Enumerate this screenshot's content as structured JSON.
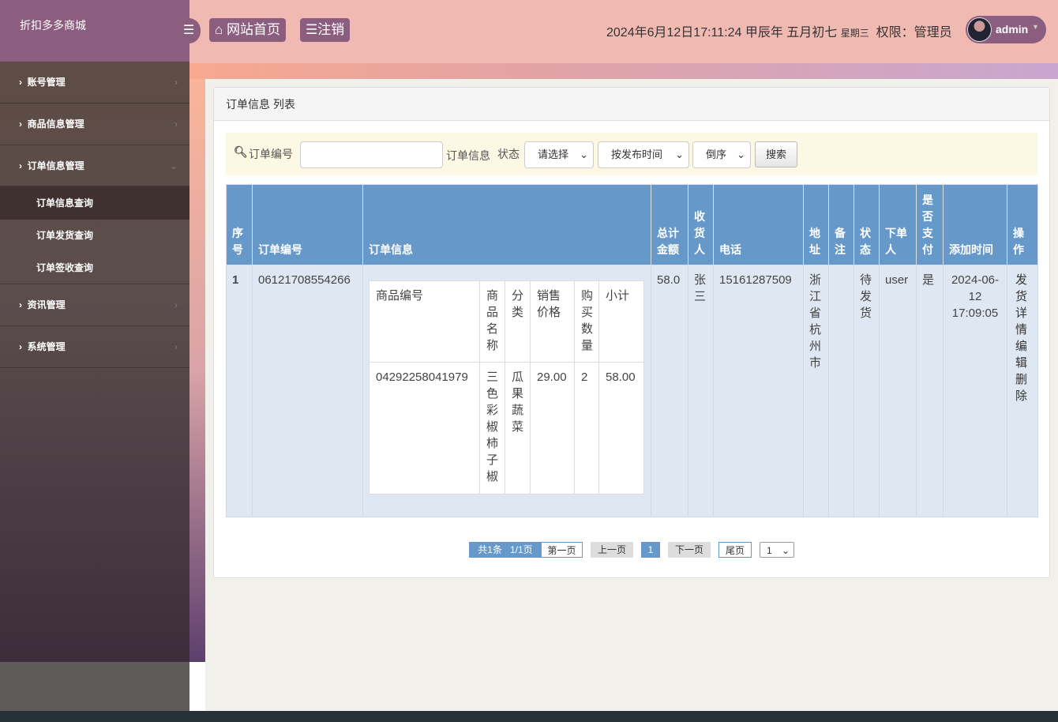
{
  "app": {
    "title": "折扣多多商城"
  },
  "topbar": {
    "home": "网站首页",
    "logout": "注销",
    "datetime": "2024年6月12日17:11:24 甲辰年 五月初七",
    "weekday": "星期三",
    "role": "权限：管理员",
    "user": "admin"
  },
  "sidebar": {
    "items": [
      {
        "label": "账号管理"
      },
      {
        "label": "商品信息管理"
      },
      {
        "label": "订单信息管理"
      },
      {
        "label": "资讯管理"
      },
      {
        "label": "系统管理"
      }
    ],
    "sub": [
      {
        "label": "订单信息查询"
      },
      {
        "label": "订单发货查询"
      },
      {
        "label": "订单签收查询"
      }
    ]
  },
  "card": {
    "title": "订单信息 列表"
  },
  "search": {
    "order_no_label": "订单编号",
    "order_no_value": "",
    "info_label": "订单信息",
    "status_label": "状态",
    "status_select": "请选择",
    "sort_select": "按发布时间",
    "order_select": "倒序",
    "button": "搜索"
  },
  "table": {
    "headers": [
      "序号",
      "订单编号",
      "订单信息",
      "总计金额",
      "收货人",
      "电话",
      "地址",
      "备注",
      "状态",
      "下单人",
      "是否支付",
      "添加时间",
      "操作"
    ],
    "rows": [
      {
        "index": "1",
        "order_no": "06121708554266",
        "total": "58.0",
        "receiver": "张三",
        "phone": "15161287509",
        "address": "浙江省杭州市",
        "remark": "",
        "status": "待发货",
        "user": "user",
        "paid": "是",
        "time": "2024-06-12 17:09:05",
        "actions": [
          "发货",
          "详情",
          "编辑",
          "删除"
        ],
        "items_headers": [
          "商品编号",
          "商品名称",
          "分类",
          "销售价格",
          "购买数量",
          "小计"
        ],
        "items": [
          [
            "04292258041979",
            "三色彩椒柿子椒",
            "瓜果蔬菜",
            "29.00",
            "2",
            "58.00"
          ]
        ]
      }
    ]
  },
  "pager": {
    "summary": "共1条",
    "pages": "1/1页",
    "first": "第一页",
    "prev": "上一页",
    "current": "1",
    "next": "下一页",
    "last": "尾页",
    "jump": "1"
  }
}
